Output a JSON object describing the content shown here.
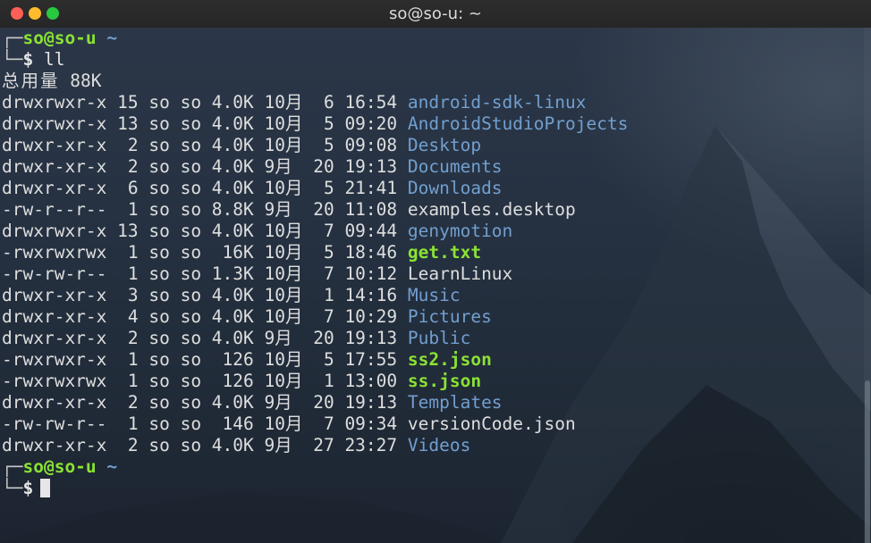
{
  "window": {
    "title": "so@so-u: ~"
  },
  "prompt": {
    "corner_top": "┌─",
    "corner_bottom": "└─",
    "user": "so@so-u",
    "dir": "~",
    "symbol": "$",
    "command": "ll"
  },
  "total": {
    "label": "总用量",
    "value": "88K"
  },
  "files": [
    {
      "perm": "drwxrwxr-x",
      "links": "15",
      "owner": "so",
      "group": "so",
      "size": "4.0K",
      "month": "10月",
      "day": "6",
      "time": "16:54",
      "name": "android-sdk-linux",
      "kind": "dir"
    },
    {
      "perm": "drwxrwxr-x",
      "links": "13",
      "owner": "so",
      "group": "so",
      "size": "4.0K",
      "month": "10月",
      "day": "5",
      "time": "09:20",
      "name": "AndroidStudioProjects",
      "kind": "dir"
    },
    {
      "perm": "drwxr-xr-x",
      "links": "2",
      "owner": "so",
      "group": "so",
      "size": "4.0K",
      "month": "10月",
      "day": "5",
      "time": "09:08",
      "name": "Desktop",
      "kind": "dir"
    },
    {
      "perm": "drwxr-xr-x",
      "links": "2",
      "owner": "so",
      "group": "so",
      "size": "4.0K",
      "month": "9月",
      "day": "20",
      "time": "19:13",
      "name": "Documents",
      "kind": "dir"
    },
    {
      "perm": "drwxr-xr-x",
      "links": "6",
      "owner": "so",
      "group": "so",
      "size": "4.0K",
      "month": "10月",
      "day": "5",
      "time": "21:41",
      "name": "Downloads",
      "kind": "dir"
    },
    {
      "perm": "-rw-r--r--",
      "links": "1",
      "owner": "so",
      "group": "so",
      "size": "8.8K",
      "month": "9月",
      "day": "20",
      "time": "11:08",
      "name": "examples.desktop",
      "kind": "file"
    },
    {
      "perm": "drwxrwxr-x",
      "links": "13",
      "owner": "so",
      "group": "so",
      "size": "4.0K",
      "month": "10月",
      "day": "7",
      "time": "09:44",
      "name": "genymotion",
      "kind": "dir"
    },
    {
      "perm": "-rwxrwxrwx",
      "links": "1",
      "owner": "so",
      "group": "so",
      "size": "16K",
      "month": "10月",
      "day": "5",
      "time": "18:46",
      "name": "get.txt",
      "kind": "exec"
    },
    {
      "perm": "-rw-rw-r--",
      "links": "1",
      "owner": "so",
      "group": "so",
      "size": "1.3K",
      "month": "10月",
      "day": "7",
      "time": "10:12",
      "name": "LearnLinux",
      "kind": "file"
    },
    {
      "perm": "drwxr-xr-x",
      "links": "3",
      "owner": "so",
      "group": "so",
      "size": "4.0K",
      "month": "10月",
      "day": "1",
      "time": "14:16",
      "name": "Music",
      "kind": "dir"
    },
    {
      "perm": "drwxr-xr-x",
      "links": "4",
      "owner": "so",
      "group": "so",
      "size": "4.0K",
      "month": "10月",
      "day": "7",
      "time": "10:29",
      "name": "Pictures",
      "kind": "dir"
    },
    {
      "perm": "drwxr-xr-x",
      "links": "2",
      "owner": "so",
      "group": "so",
      "size": "4.0K",
      "month": "9月",
      "day": "20",
      "time": "19:13",
      "name": "Public",
      "kind": "dir"
    },
    {
      "perm": "-rwxrwxr-x",
      "links": "1",
      "owner": "so",
      "group": "so",
      "size": "126",
      "month": "10月",
      "day": "5",
      "time": "17:55",
      "name": "ss2.json",
      "kind": "exec"
    },
    {
      "perm": "-rwxrwxrwx",
      "links": "1",
      "owner": "so",
      "group": "so",
      "size": "126",
      "month": "10月",
      "day": "1",
      "time": "13:00",
      "name": "ss.json",
      "kind": "exec"
    },
    {
      "perm": "drwxr-xr-x",
      "links": "2",
      "owner": "so",
      "group": "so",
      "size": "4.0K",
      "month": "9月",
      "day": "20",
      "time": "19:13",
      "name": "Templates",
      "kind": "dir"
    },
    {
      "perm": "-rw-rw-r--",
      "links": "1",
      "owner": "so",
      "group": "so",
      "size": "146",
      "month": "10月",
      "day": "7",
      "time": "09:34",
      "name": "versionCode.json",
      "kind": "file"
    },
    {
      "perm": "drwxr-xr-x",
      "links": "2",
      "owner": "so",
      "group": "so",
      "size": "4.0K",
      "month": "9月",
      "day": "27",
      "time": "23:27",
      "name": "Videos",
      "kind": "dir"
    }
  ],
  "colors": {
    "directory": "#729fcf",
    "executable": "#8ae234",
    "file": "#dedede",
    "user": "#8ae234"
  },
  "icons": [
    "close-icon",
    "minimize-icon",
    "maximize-icon"
  ]
}
